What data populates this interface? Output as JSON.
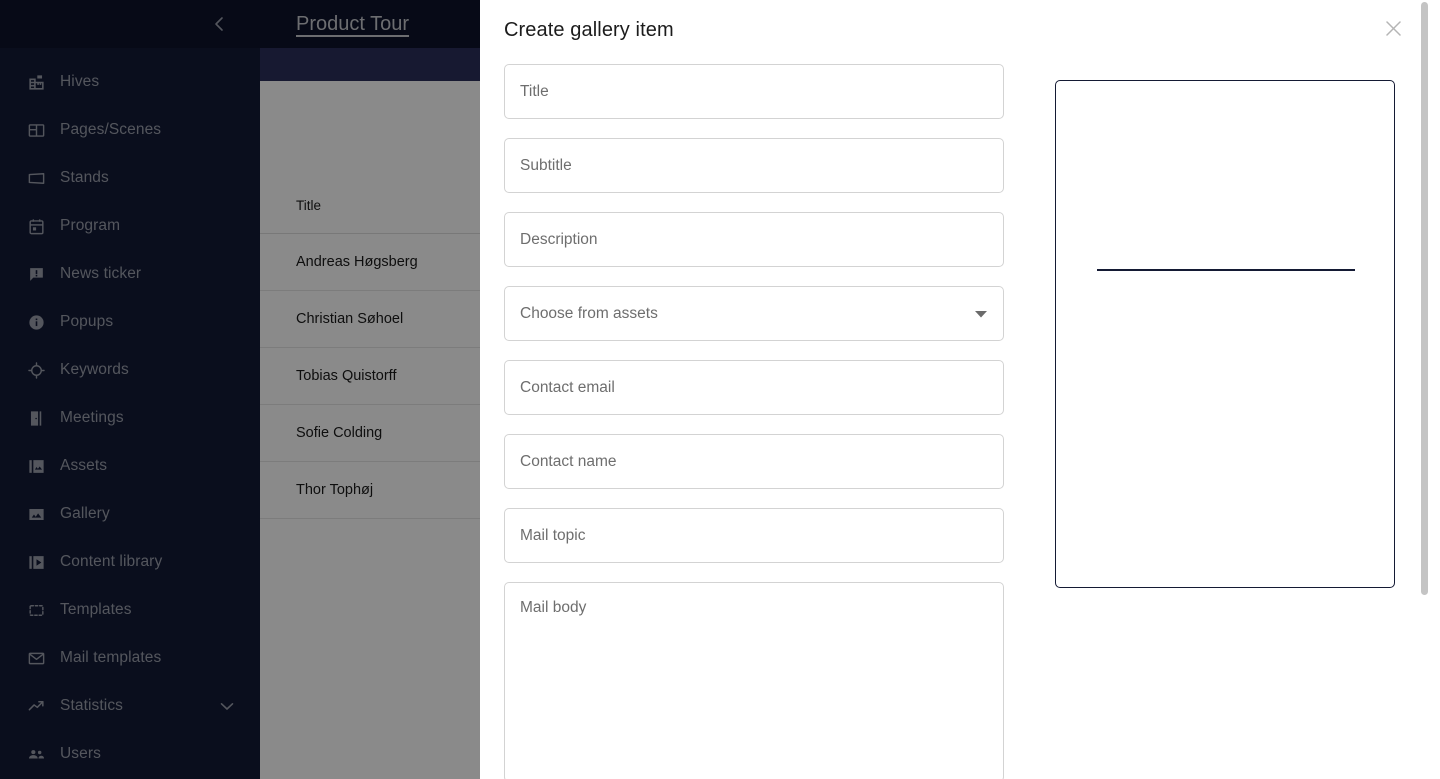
{
  "sidebar": {
    "collapse_icon": "chevron-left-icon",
    "items": [
      {
        "label": "Hives",
        "icon": "building-icon",
        "has_caret": false
      },
      {
        "label": "Pages/Scenes",
        "icon": "layout-icon",
        "has_caret": false
      },
      {
        "label": "Stands",
        "icon": "banner-icon",
        "has_caret": false
      },
      {
        "label": "Program",
        "icon": "calendar-icon",
        "has_caret": false
      },
      {
        "label": "News ticker",
        "icon": "announcement-icon",
        "has_caret": false
      },
      {
        "label": "Popups",
        "icon": "info-circle-icon",
        "has_caret": false
      },
      {
        "label": "Keywords",
        "icon": "target-icon",
        "has_caret": false
      },
      {
        "label": "Meetings",
        "icon": "door-icon",
        "has_caret": false
      },
      {
        "label": "Assets",
        "icon": "images-icon",
        "has_caret": false
      },
      {
        "label": "Gallery",
        "icon": "image-icon",
        "has_caret": false
      },
      {
        "label": "Content library",
        "icon": "video-library-icon",
        "has_caret": false
      },
      {
        "label": "Templates",
        "icon": "template-icon",
        "has_caret": false
      },
      {
        "label": "Mail templates",
        "icon": "envelope-icon",
        "has_caret": false
      },
      {
        "label": "Statistics",
        "icon": "trending-up-icon",
        "has_caret": true
      },
      {
        "label": "Users",
        "icon": "people-icon",
        "has_caret": false
      }
    ]
  },
  "main": {
    "title": "Product Tour",
    "table": {
      "columns": [
        "Title"
      ],
      "rows": [
        [
          "Andreas Høgsberg"
        ],
        [
          "Christian Søhoel"
        ],
        [
          "Tobias Quistorff"
        ],
        [
          "Sofie Colding"
        ],
        [
          "Thor Tophøj"
        ]
      ]
    }
  },
  "modal": {
    "title": "Create gallery item",
    "close_icon": "close-icon",
    "fields": [
      {
        "name": "title",
        "placeholder": "Title",
        "value": "",
        "type": "text"
      },
      {
        "name": "subtitle",
        "placeholder": "Subtitle",
        "value": "",
        "type": "text"
      },
      {
        "name": "description",
        "placeholder": "Description",
        "value": "",
        "type": "text"
      },
      {
        "name": "asset",
        "placeholder": "Choose from assets",
        "value": "",
        "type": "select"
      },
      {
        "name": "contact_email",
        "placeholder": "Contact email",
        "value": "",
        "type": "text"
      },
      {
        "name": "contact_name",
        "placeholder": "Contact name",
        "value": "",
        "type": "text"
      },
      {
        "name": "mail_topic",
        "placeholder": "Mail topic",
        "value": "",
        "type": "text"
      },
      {
        "name": "mail_body",
        "placeholder": "Mail body",
        "value": "",
        "type": "textarea"
      }
    ],
    "select_caret_icon": "chevron-down-icon",
    "preview": {
      "divider_color": "#141a34",
      "border_color": "#141a34"
    }
  },
  "colors": {
    "sidebar_bg": "#131a36",
    "header_bg": "#0e142c",
    "subbar_bg": "#2b2f5c",
    "nav_text": "#9ba0ad",
    "modal_bg": "#ffffff",
    "field_border": "#d3d3d3",
    "placeholder": "#6e6e6e",
    "scrim": "rgba(0,0,0,0.46)"
  }
}
